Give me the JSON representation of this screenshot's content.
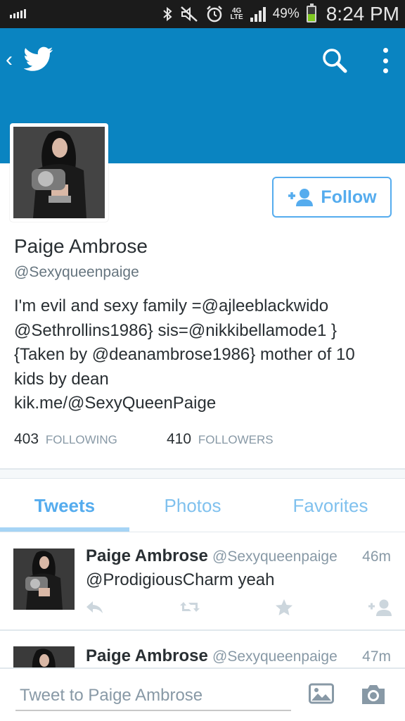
{
  "status_bar": {
    "battery_percent": "49%",
    "battery_level": 0.49,
    "time": "8:24 PM",
    "network": "4G LTE",
    "icons": [
      "signal-small-icon",
      "bluetooth-icon",
      "mute-icon",
      "alarm-icon",
      "4g-lte-icon",
      "cell-signal-icon",
      "battery-icon"
    ]
  },
  "app_bar": {
    "back_icon": "chevron-left-icon",
    "logo_icon": "twitter-bird-icon",
    "search_icon": "search-icon",
    "more_icon": "more-vertical-icon",
    "header_color": "#0a84c1"
  },
  "profile": {
    "name": "Paige Ambrose",
    "handle": "@Sexyqueenpaige",
    "bio_lines": [
      "I'm evil and sexy family =@ajleeblackwido",
      "@Sethrollins1986} sis=@nikkibellamode1 }",
      "{Taken by @deanambrose1986} mother of 10",
      "kids by dean",
      "kik.me/@SexyQueenPaige"
    ],
    "follow_label": "Follow",
    "following_count": "403",
    "following_label": "FOLLOWING",
    "followers_count": "410",
    "followers_label": "FOLLOWERS"
  },
  "tabs": [
    {
      "label": "Tweets",
      "active": true
    },
    {
      "label": "Photos",
      "active": false
    },
    {
      "label": "Favorites",
      "active": false
    }
  ],
  "tweets": [
    {
      "author": "Paige Ambrose",
      "handle": "@Sexyqueenpaige",
      "time": "46m",
      "text": "@ProdigiousCharm yeah"
    },
    {
      "author": "Paige Ambrose",
      "handle": "@Sexyqueenpaige",
      "time": "47m",
      "text": ""
    }
  ],
  "compose": {
    "placeholder": "Tweet to Paige Ambrose"
  },
  "colors": {
    "accent": "#55acee",
    "header": "#0a84c1",
    "text": "#292f33",
    "muted": "#8899a6"
  }
}
